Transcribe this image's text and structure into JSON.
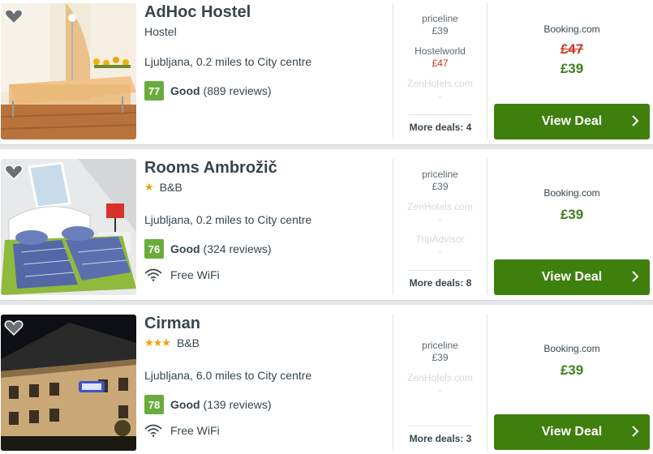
{
  "hotels": [
    {
      "name": "AdHoc Hostel",
      "stars": "",
      "type": "Hostel",
      "location": "Ljubljana, 0.2 miles to City centre",
      "score": "77",
      "rating_word": "Good",
      "reviews": "(889 reviews)",
      "amenity": "",
      "deals": [
        {
          "provider": "priceline",
          "price": "£39",
          "style": "normal"
        },
        {
          "provider": "Hostelworld",
          "price": "£47",
          "style": "red"
        },
        {
          "provider": "ZenHotels.com",
          "price": "-",
          "style": "faded"
        }
      ],
      "more_deals": "More deals: 4",
      "main_provider": "Booking.com",
      "old_price": "£47",
      "price": "£39",
      "button": "View Deal"
    },
    {
      "name": "Rooms Ambrožič",
      "stars": "★",
      "type": "B&B",
      "location": "Ljubljana, 0.2 miles to City centre",
      "score": "76",
      "rating_word": "Good",
      "reviews": "(324 reviews)",
      "amenity": "Free WiFi",
      "deals": [
        {
          "provider": "priceline",
          "price": "£39",
          "style": "normal"
        },
        {
          "provider": "ZenHotels.com",
          "price": "-",
          "style": "faded"
        },
        {
          "provider": "TripAdvisor",
          "price": "-",
          "style": "faded"
        }
      ],
      "more_deals": "More deals: 8",
      "main_provider": "Booking.com",
      "old_price": "",
      "price": "£39",
      "button": "View Deal"
    },
    {
      "name": "Cirman",
      "stars": "★★★",
      "type": "B&B",
      "location": "Ljubljana, 6.0 miles to City centre",
      "score": "78",
      "rating_word": "Good",
      "reviews": "(139 reviews)",
      "amenity": "Free WiFi",
      "deals": [
        {
          "provider": "priceline",
          "price": "£39",
          "style": "normal"
        },
        {
          "provider": "ZenHotels.com",
          "price": "-",
          "style": "faded"
        }
      ],
      "more_deals": "More deals: 3",
      "main_provider": "Booking.com",
      "old_price": "",
      "price": "£39",
      "button": "View Deal"
    }
  ],
  "colors": {
    "accent_green": "#3f7f0e",
    "score_green": "#6aac3c",
    "price_green": "#3e7f1c",
    "price_red": "#d1341c",
    "star_orange": "#f29f05"
  },
  "icons": {
    "favorite": "heart-icon",
    "wifi": "wifi-icon",
    "button_arrow": "chevron-right-icon",
    "star": "star-icon"
  }
}
